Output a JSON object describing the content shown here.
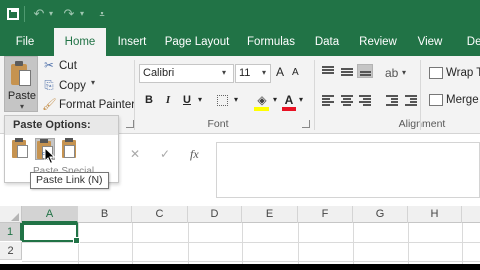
{
  "qat": {
    "save_icon": "save-icon",
    "undo_icon": "↶",
    "redo_icon": "↷",
    "dropdown": "▾",
    "customize": "⩡"
  },
  "tabs": [
    {
      "label": "File"
    },
    {
      "label": "Home"
    },
    {
      "label": "Insert"
    },
    {
      "label": "Page Layout"
    },
    {
      "label": "Formulas"
    },
    {
      "label": "Data"
    },
    {
      "label": "Review"
    },
    {
      "label": "View"
    },
    {
      "label": "Dev"
    }
  ],
  "active_tab": "Home",
  "clipboard": {
    "paste_label": "Paste",
    "cut_label": "Cut",
    "copy_label": "Copy",
    "format_painter_label": "Format Painter",
    "dropdown": "▾"
  },
  "font": {
    "name": "Calibri",
    "size": "11",
    "grow": "A",
    "shrink": "A",
    "bold": "B",
    "italic": "I",
    "underline": "U",
    "group_label": "Font",
    "fill_glyph": "◈",
    "font_color_glyph": "A",
    "dropdown": "▾"
  },
  "alignment": {
    "orientation_glyph": "ab",
    "wrap_text": "Wrap T",
    "merge": "Merge",
    "group_label": "Alignment"
  },
  "paste_menu": {
    "title": "Paste Options:",
    "ghost_text": "Paste Special..."
  },
  "tooltip": "Paste Link (N)",
  "formula_bar": {
    "cancel": "✕",
    "enter": "✓",
    "fx": "fx"
  },
  "columns": [
    "A",
    "B",
    "C",
    "D",
    "E",
    "F",
    "G",
    "H"
  ],
  "rows": [
    "1",
    "2"
  ],
  "colors": {
    "brand_green": "#217346",
    "ribbon_bg": "#f3f3f3",
    "fill_color": "#ffff00",
    "font_color": "#e81123"
  }
}
